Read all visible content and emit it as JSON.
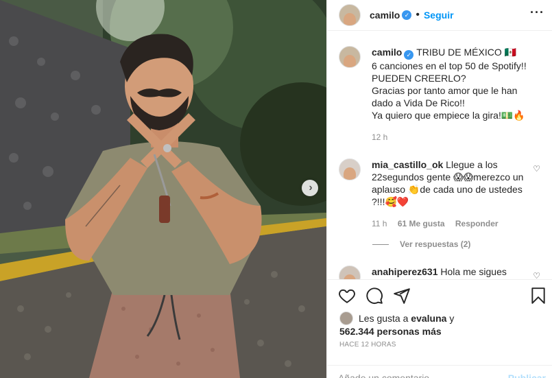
{
  "post": {
    "author": "camilo",
    "follow_label": "Seguir",
    "separator": "•",
    "more_label": "···",
    "next_label": "›"
  },
  "caption": {
    "author": "camilo",
    "lines": [
      "TRIBU DE MÉXICO 🇲🇽",
      "6 canciones en el top 50 de Spotify!!",
      "PUEDEN CREERLO?",
      "Gracias por tanto amor que le han",
      "dado a Vida De Rico!!",
      "Ya quiero que empiece la gira!💵🔥"
    ],
    "time": "12 h"
  },
  "comments": [
    {
      "author": "mia_castillo_ok",
      "text": "Llegue a los 22segundos gente 😱😱merezco un aplauso 👏de cada uno de ustedes ?!!!🥰❤️",
      "time": "11 h",
      "likes": "61 Me gusta",
      "reply_label": "Responder"
    },
    {
      "author": "anahiperez631",
      "text": "Hola me sigues"
    }
  ],
  "view_replies": "Ver respuestas (2)",
  "likes": {
    "prefix": "Les gusta a",
    "liker": "evaluna",
    "conj": "y",
    "count": "562.344 personas más"
  },
  "timestamp": "HACE 12 HORAS",
  "add_comment": {
    "placeholder": "Añade un comentario...",
    "publish_label": "Publicar"
  },
  "colors": {
    "link_blue": "#0095f6",
    "verified_blue": "#3897f0",
    "muted_gray": "#8e8e8e",
    "publish_disabled": "#b2dffc"
  },
  "icons": [
    "heart-icon",
    "comment-icon",
    "share-icon",
    "bookmark-icon",
    "verified-badge-icon",
    "chevron-right-icon",
    "more-options-icon"
  ]
}
